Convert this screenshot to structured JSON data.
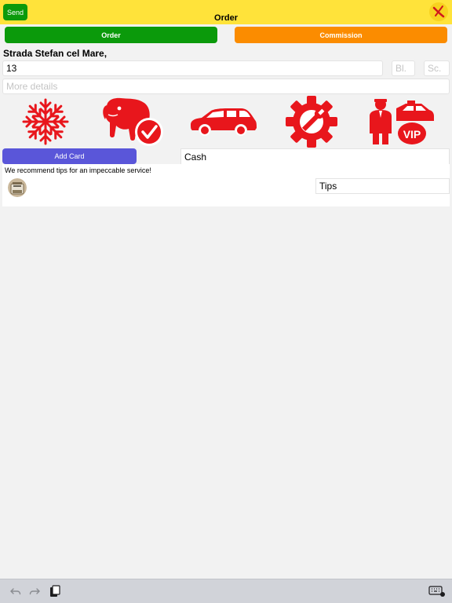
{
  "header": {
    "send_label": "Send",
    "title": "Order",
    "logo_icon": "x-logo-icon",
    "bar_color": "#ffe33a"
  },
  "tabs": [
    {
      "label": "Order",
      "color": "#0b9a0b"
    },
    {
      "label": "Commission",
      "color": "#fb8c00"
    }
  ],
  "address": {
    "street": "Strada Stefan cel Mare,",
    "number_value": "13",
    "block_placeholder": "Bl.",
    "stair_placeholder": "Sc.",
    "details_placeholder": "More details"
  },
  "services": [
    {
      "icon": "snowflake-icon"
    },
    {
      "icon": "pet-check-icon"
    },
    {
      "icon": "car-icon"
    },
    {
      "icon": "gear-wrench-icon"
    },
    {
      "icon": "vip-driver-icon"
    }
  ],
  "payment": {
    "add_card_label": "Add Card",
    "method": "Cash"
  },
  "tips": {
    "recommendation": "We recommend tips for an impeccable service!",
    "image_icon": "tips-jar-icon",
    "field_value": "Tips"
  },
  "keyboard_bar": {
    "icons": [
      "undo-icon",
      "redo-icon",
      "paste-icon",
      "keyboard-icon"
    ]
  },
  "colors": {
    "accent_red": "#e8161c",
    "add_card": "#5a56d9"
  }
}
